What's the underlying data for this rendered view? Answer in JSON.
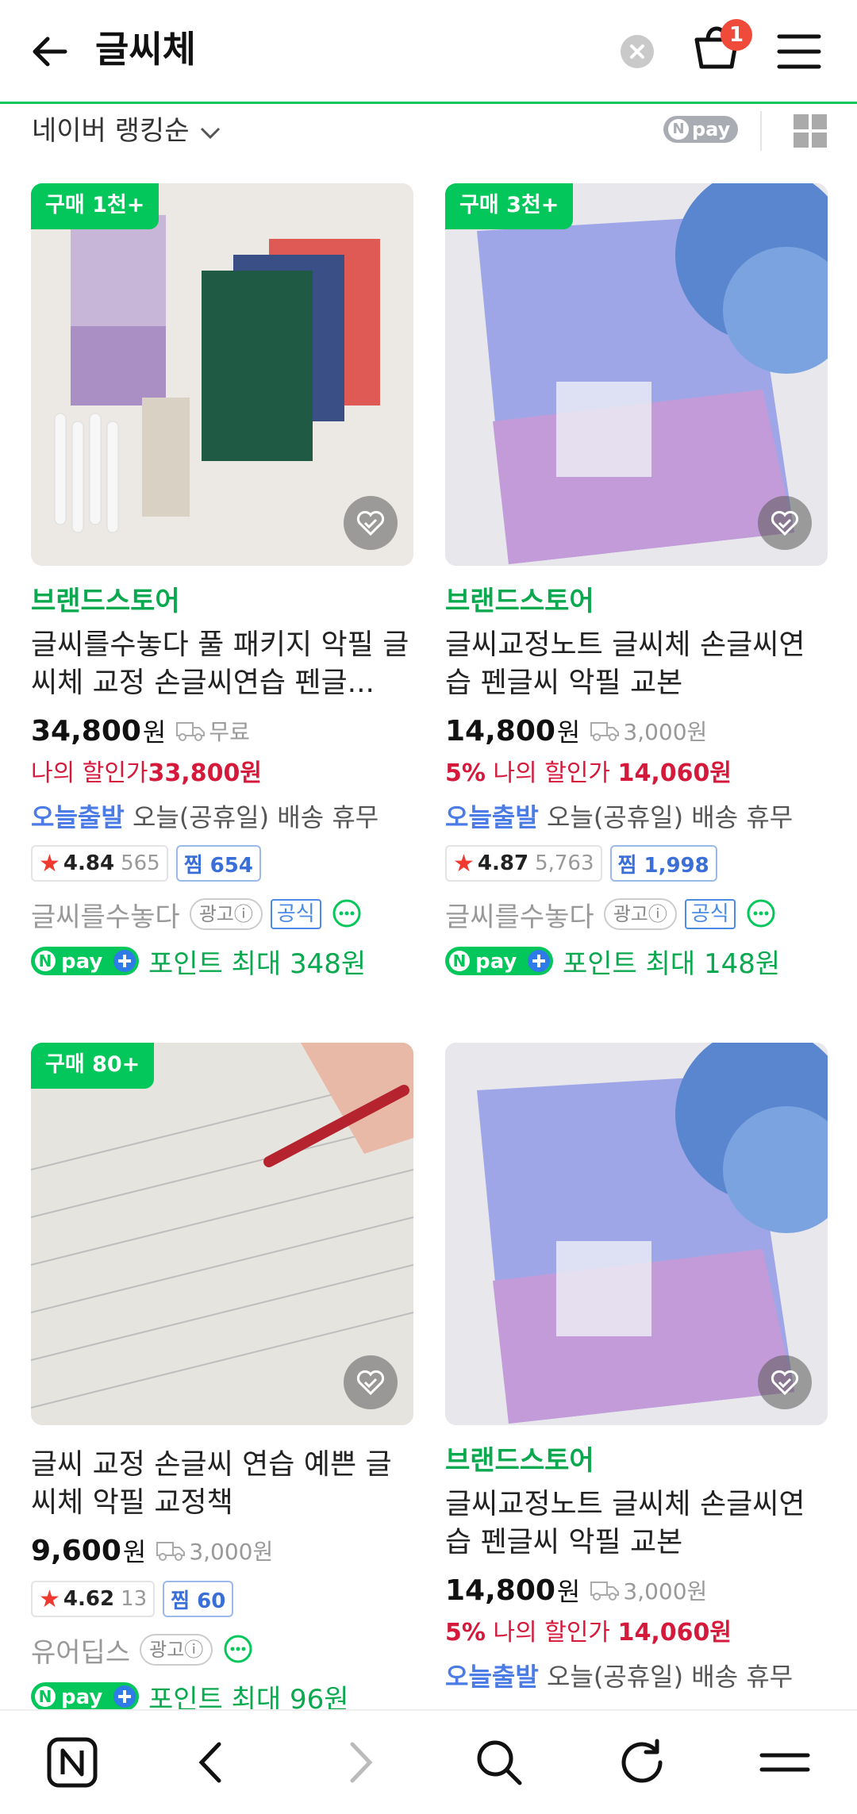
{
  "header": {
    "title": "글씨체",
    "cart_count": "1"
  },
  "sort": {
    "label": "네이버 랭킹순",
    "npay_label": "pay"
  },
  "products": [
    {
      "badge": "구매 1천+",
      "brand": "브랜드스토어",
      "name": "글씨를수놓다 풀 패키지 악필 글씨체 교정 손글씨연습 펜글...",
      "price": "34,800",
      "won": "원",
      "shipping": "무료",
      "discount_prefix": "",
      "discount_label": "나의 할인가",
      "discount_price": "33,800원",
      "today_label": "오늘출발",
      "today_text": "오늘(공휴일) 배송 휴무",
      "rating": "4.84",
      "reviews": "565",
      "zzim": "찜 654",
      "seller": "글씨를수놓다",
      "ad": "광고ⓘ",
      "official": "공식",
      "points": "포인트 최대 348원"
    },
    {
      "badge": "구매 3천+",
      "brand": "브랜드스토어",
      "name": "글씨교정노트 글씨체 손글씨연습 펜글씨 악필 교본",
      "price": "14,800",
      "won": "원",
      "shipping": "3,000원",
      "discount_prefix": "5%",
      "discount_label": "나의 할인가",
      "discount_price": "14,060원",
      "today_label": "오늘출발",
      "today_text": "오늘(공휴일) 배송 휴무",
      "rating": "4.87",
      "reviews": "5,763",
      "zzim": "찜 1,998",
      "seller": "글씨를수놓다",
      "ad": "광고ⓘ",
      "official": "공식",
      "points": "포인트 최대 148원"
    },
    {
      "badge": "구매 80+",
      "name": "글씨 교정 손글씨 연습 예쁜 글씨체 악필 교정책",
      "price": "9,600",
      "won": "원",
      "shipping": "3,000원",
      "rating": "4.62",
      "reviews": "13",
      "zzim": "찜 60",
      "seller": "유어딥스",
      "ad": "광고ⓘ",
      "points": "포인트 최대 96원"
    },
    {
      "brand": "브랜드스토어",
      "name": "글씨교정노트 글씨체 손글씨연습 펜글씨 악필 교본",
      "price": "14,800",
      "won": "원",
      "shipping": "3,000원",
      "discount_prefix": "5%",
      "discount_label": "나의 할인가",
      "discount_price": "14,060원",
      "today_label": "오늘출발",
      "today_text": "오늘(공휴일) 배송 휴무"
    }
  ],
  "npay_plus_label": "pay",
  "colors": {
    "accent": "#03c75a",
    "discount": "#d4193b",
    "link_blue": "#4b7be5"
  }
}
